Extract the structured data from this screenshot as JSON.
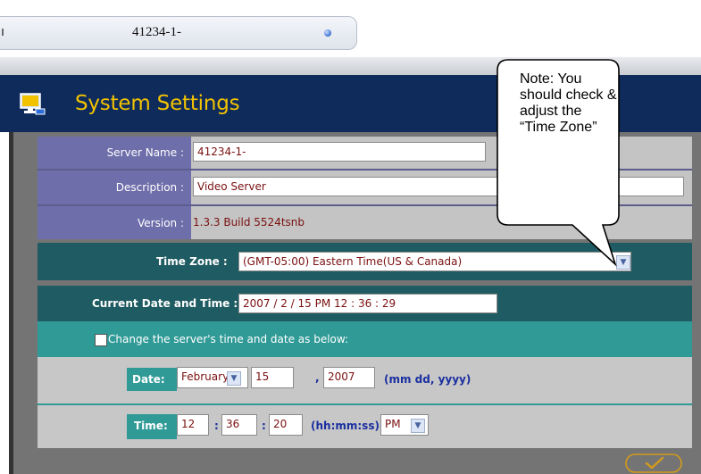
{
  "tab": {
    "title": "41234-1-"
  },
  "header": {
    "title": "System Settings"
  },
  "server": {
    "name_label": "Server Name :",
    "name_value": "41234-1-",
    "description_label": "Description :",
    "description_value": "Video Server",
    "version_label": "Version :",
    "version_value": "1.3.3 Build 5524tsnb"
  },
  "timezone": {
    "label": "Time Zone :",
    "selected": "(GMT-05:00) Eastern Time(US & Canada)"
  },
  "current": {
    "label": "Current Date and Time :",
    "value": "2007 / 2 / 15 PM 12 : 36 : 29"
  },
  "change": {
    "checkbox_label": "Change the server's time and date as below:",
    "checked": false,
    "date_label": "Date:",
    "month": "February",
    "day": "15",
    "date_comma": ",",
    "year": "2007",
    "date_format": "(mm dd, yyyy)",
    "time_label": "Time:",
    "hour": "12",
    "time_sep1": ":",
    "minute": "36",
    "time_sep2": ":",
    "second": "20",
    "time_format": "(hh:mm:ss)",
    "ampm": "PM"
  },
  "callout": {
    "text": "Note: You should check & adjust the “Time Zone”"
  },
  "apply_icon": "checkmark-icon"
}
